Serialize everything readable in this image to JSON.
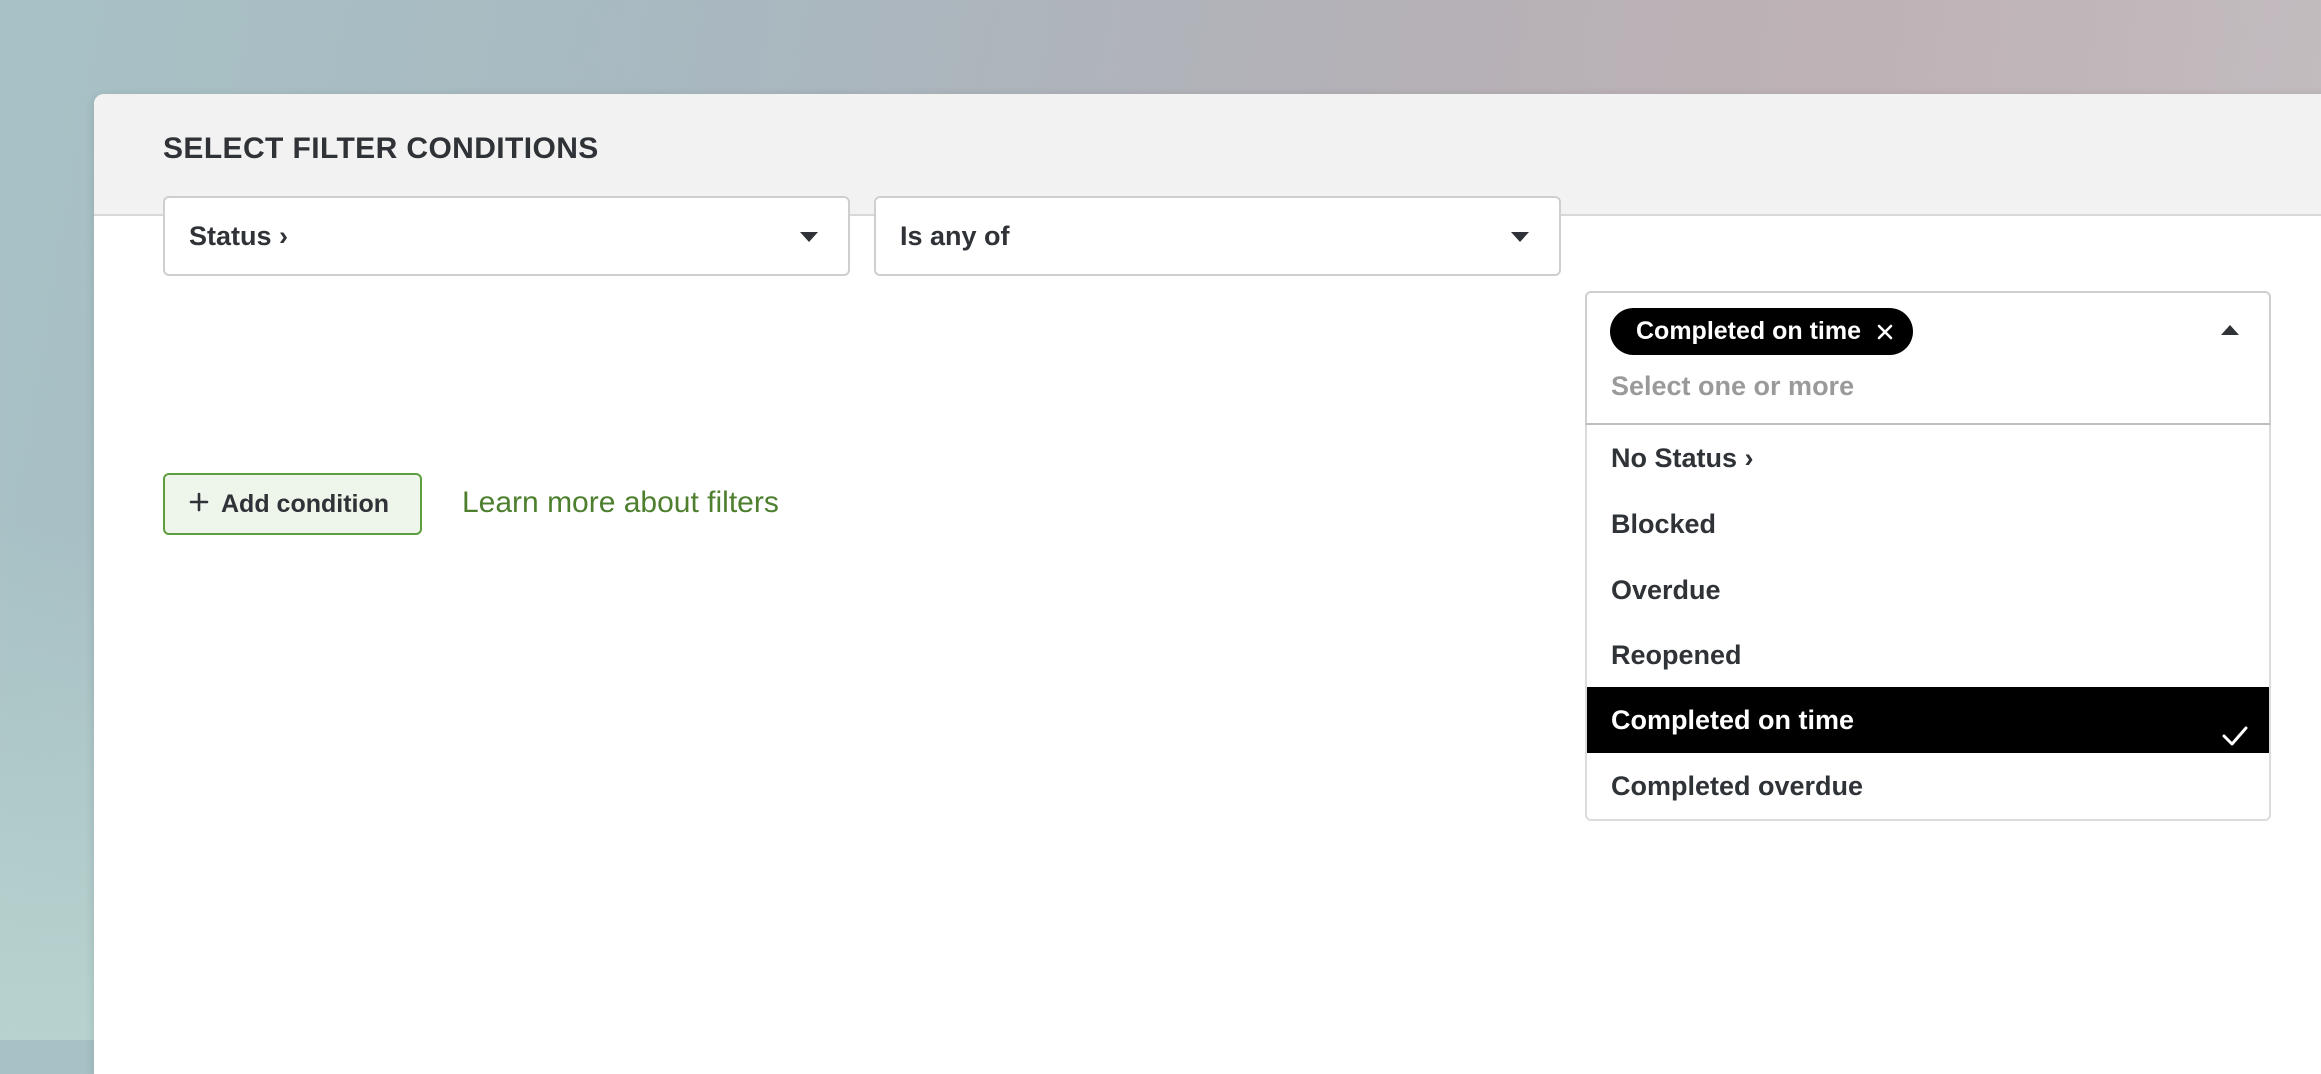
{
  "dialog": {
    "title": "SELECT FILTER CONDITIONS"
  },
  "condition": {
    "field": "Status ›",
    "operator": "Is any of",
    "values": {
      "chips": [
        "Completed on time"
      ],
      "placeholder": "Select one or more",
      "options": [
        {
          "label": "No Status ›",
          "selected": false
        },
        {
          "label": "Blocked",
          "selected": false
        },
        {
          "label": "Overdue",
          "selected": false
        },
        {
          "label": "Reopened",
          "selected": false
        },
        {
          "label": "Completed on time",
          "selected": true
        },
        {
          "label": "Completed overdue",
          "selected": false
        }
      ]
    }
  },
  "actions": {
    "add_condition": "Add condition",
    "learn_more": "Learn more about filters"
  },
  "colors": {
    "accent_green": "#5e9e3f",
    "link_green": "#4d7f2e",
    "selected_bg": "#000000"
  },
  "icons": {
    "add": "plus-icon",
    "chip_remove": "close-icon",
    "selected_option": "check-icon",
    "dropdown": "caret-down-icon",
    "dropdown_open": "caret-up-icon"
  }
}
